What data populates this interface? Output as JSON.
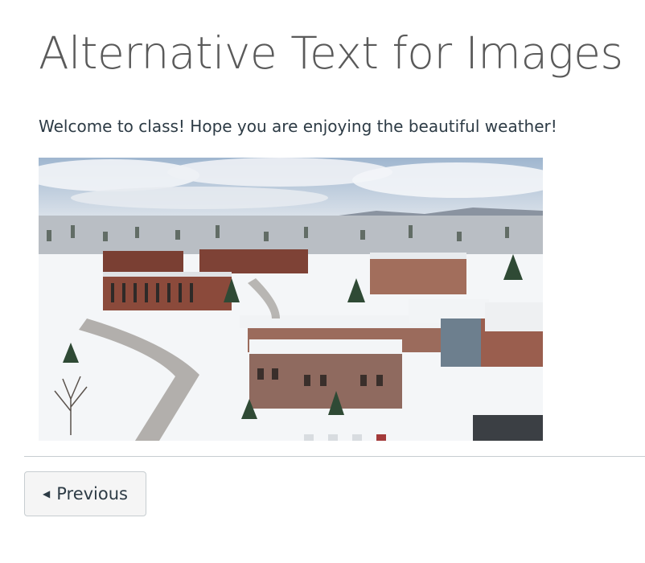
{
  "page": {
    "title": "Alternative Text for Images",
    "intro": "Welcome to class! Hope you are enjoying the beautiful weather!"
  },
  "image": {
    "subject": "aerial view of snowy university campus"
  },
  "nav": {
    "previous_icon": "caret-left-icon",
    "previous_label": "Previous"
  },
  "colors": {
    "text": "#2d3b45",
    "title": "#5a5a5a",
    "divider": "#c7cdd1",
    "button_bg": "#f5f5f5"
  }
}
